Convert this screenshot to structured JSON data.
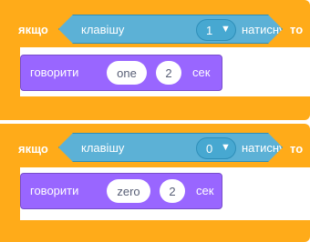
{
  "blocks": [
    {
      "if_label": "якщо",
      "sensing": {
        "prefix": "клавішу",
        "key": "1",
        "suffix": "натиснуто?"
      },
      "then_label": "то",
      "say": {
        "label": "говорити",
        "message": "one",
        "seconds": "2",
        "unit": "сек"
      }
    },
    {
      "if_label": "якщо",
      "sensing": {
        "prefix": "клавішу",
        "key": "0",
        "suffix": "натиснуто?"
      },
      "then_label": "то",
      "say": {
        "label": "говорити",
        "message": "zero",
        "seconds": "2",
        "unit": "сек"
      }
    }
  ],
  "colors": {
    "control": "#FFAB19",
    "sensing": "#5CB1D6",
    "looks": "#9966FF",
    "background": "#FFFFFF"
  },
  "icons": [
    "chevron-down-icon"
  ]
}
